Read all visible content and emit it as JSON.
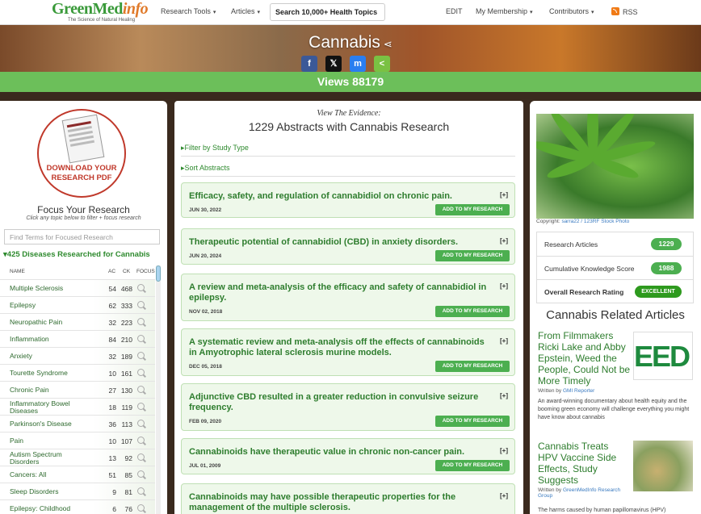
{
  "nav": {
    "logo_main": "GreenMed",
    "logo_accent": "info",
    "logo_tagline": "The Science of Natural Healing",
    "research_tools": "Research Tools",
    "articles": "Articles",
    "search_label": "Search 10,000+ Health Topics",
    "edit": "EDIT",
    "membership": "My Membership",
    "contributors": "Contributors",
    "rss": "RSS"
  },
  "hero": {
    "title": "Cannabis",
    "share_buttons": [
      {
        "name": "facebook",
        "glyph": "f",
        "color": "#3b5998"
      },
      {
        "name": "x",
        "glyph": "𝕏",
        "color": "#111111"
      },
      {
        "name": "messenger",
        "glyph": "m",
        "color": "#2a7ef0"
      },
      {
        "name": "sharethis",
        "glyph": "<",
        "color": "#7ac143"
      }
    ],
    "views": "Views 88179"
  },
  "left": {
    "pdf_line1": "DOWNLOAD YOUR",
    "pdf_line2": "RESEARCH PDF",
    "focus_title": "Focus Your Research",
    "focus_sub": "Click any topic below to filter + focus research",
    "find_placeholder": "Find Terms for Focused Research",
    "diseases_heading": "425 Diseases Researched for Cannabis",
    "columns": {
      "name": "NAME",
      "ac": "AC",
      "ck": "CK",
      "focus": "FOCUS"
    },
    "diseases": [
      {
        "name": "Multiple Sclerosis",
        "ac": "54",
        "ck": "468"
      },
      {
        "name": "Epilepsy",
        "ac": "62",
        "ck": "333"
      },
      {
        "name": "Neuropathic Pain",
        "ac": "32",
        "ck": "223"
      },
      {
        "name": "Inflammation",
        "ac": "84",
        "ck": "210"
      },
      {
        "name": "Anxiety",
        "ac": "32",
        "ck": "189"
      },
      {
        "name": "Tourette Syndrome",
        "ac": "10",
        "ck": "161"
      },
      {
        "name": "Chronic Pain",
        "ac": "27",
        "ck": "130"
      },
      {
        "name": "Inflammatory Bowel Diseases",
        "ac": "18",
        "ck": "119"
      },
      {
        "name": "Parkinson's Disease",
        "ac": "36",
        "ck": "113"
      },
      {
        "name": "Pain",
        "ac": "10",
        "ck": "107"
      },
      {
        "name": "Autism Spectrum Disorders",
        "ac": "13",
        "ck": "92"
      },
      {
        "name": "Cancers: All",
        "ac": "51",
        "ck": "85"
      },
      {
        "name": "Sleep Disorders",
        "ac": "9",
        "ck": "81"
      },
      {
        "name": "Epilepsy: Childhood",
        "ac": "6",
        "ck": "76"
      }
    ]
  },
  "middle": {
    "view_evidence": "View The Evidence:",
    "abstract_count": "1229 Abstracts with Cannabis Research",
    "filter_label": "Filter by Study Type",
    "sort_label": "Sort Abstracts",
    "plus_label": "[+]",
    "add_label": "ADD TO MY RESEARCH",
    "abstracts": [
      {
        "title": "Efficacy, safety, and regulation of cannabidiol on chronic pain.",
        "date": "JUN 30, 2022"
      },
      {
        "title": "Therapeutic potential of cannabidiol (CBD) in anxiety disorders.",
        "date": "JUN 20, 2024"
      },
      {
        "title": "A review and meta-analysis of the efficacy and safety of cannabidiol in epilepsy.",
        "date": "NOV 02, 2018"
      },
      {
        "title": "A systematic review and meta-analysis off the effects of cannabinoids in Amyotrophic lateral sclerosis murine models.",
        "date": "DEC 05, 2018"
      },
      {
        "title": "Adjunctive CBD resulted in a greater reduction in convulsive seizure frequency.",
        "date": "FEB 09, 2020"
      },
      {
        "title": "Cannabinoids have therapeutic value in chronic non-cancer pain.",
        "date": "JUL 01, 2009"
      },
      {
        "title": "Cannabinoids may have possible therapeutic properties for the management of the multiple sclerosis.",
        "date": ""
      }
    ]
  },
  "right": {
    "copyright_prefix": "Copyright: ",
    "copyright_link": "sarra22 / 123RF Stock Photo",
    "stats": [
      {
        "label": "Research Articles",
        "value": "1229"
      },
      {
        "label": "Cumulative Knowledge Score",
        "value": "1988"
      },
      {
        "label": "Overall Research Rating",
        "value": "EXCELLENT"
      }
    ],
    "related_title": "Cannabis Related Articles",
    "written_by": "Written by ",
    "related": [
      {
        "title": "From Filmmakers Ricki Lake and Abby Epstein, Weed the People, Could Not be More Timely",
        "author": "GMI Reporter",
        "desc": "An award-winning documentary about health equity and the booming green economy will challenge everything you might have know about cannabis",
        "thumb_text": "EED THE PE"
      },
      {
        "title": "Cannabis Treats HPV Vaccine Side Effects, Study Suggests",
        "author": "GreenMedInfo Research Group",
        "desc": "The harms caused by human papillomavirus (HPV)"
      }
    ]
  }
}
